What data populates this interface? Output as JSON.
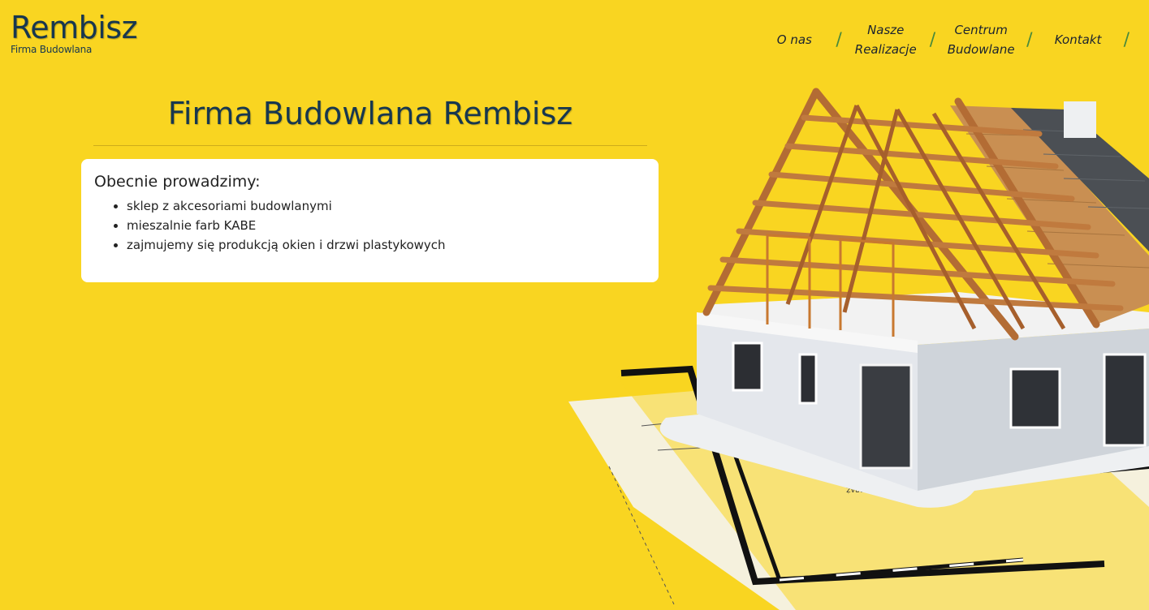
{
  "brand": {
    "name": "Rembisz",
    "tagline": "Firma Budowlana"
  },
  "nav": {
    "items": [
      {
        "line1": "O nas",
        "line2": ""
      },
      {
        "line1": "Nasze",
        "line2": "Realizacje"
      },
      {
        "line1": "Centrum",
        "line2": "Budowlane"
      },
      {
        "line1": "Kontakt",
        "line2": ""
      }
    ],
    "separator": "/"
  },
  "main": {
    "title": "Firma Budowlana Rembisz",
    "card": {
      "heading": "Obecnie prowadzimy:",
      "items": [
        "sklep z akcesoriami budowlanymi",
        "mieszalnie farb KABE",
        "zajmujemy się produkcją okien i drzwi plastykowych"
      ]
    }
  },
  "illustration": {
    "icon": "house-under-construction-illustration",
    "blueprint_text": "GARAŻ"
  },
  "colors": {
    "background": "#f9d521",
    "brand_text": "#17374f",
    "nav_separator": "#4a8a3b",
    "card": "#ffffff"
  }
}
